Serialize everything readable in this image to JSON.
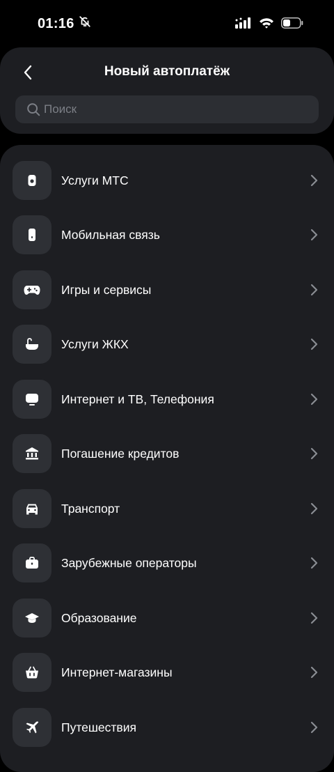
{
  "status_bar": {
    "time": "01:16",
    "icons": [
      "bell-slash-icon",
      "cellular-signal-icon",
      "wifi-icon",
      "battery-icon"
    ]
  },
  "header": {
    "title": "Новый автоплатёж",
    "back_icon": "chevron-left-icon"
  },
  "search": {
    "placeholder": "Поиск",
    "value": ""
  },
  "categories": [
    {
      "label": "Услуги МТС",
      "icon": "mts-icon"
    },
    {
      "label": "Мобильная связь",
      "icon": "phone-icon"
    },
    {
      "label": "Игры и сервисы",
      "icon": "gamepad-icon"
    },
    {
      "label": "Услуги ЖКХ",
      "icon": "bathtub-icon"
    },
    {
      "label": "Интернет и ТВ, Телефония",
      "icon": "tv-icon"
    },
    {
      "label": "Погашение кредитов",
      "icon": "bank-icon"
    },
    {
      "label": "Транспорт",
      "icon": "car-icon"
    },
    {
      "label": "Зарубежные операторы",
      "icon": "briefcase-icon"
    },
    {
      "label": "Образование",
      "icon": "graduation-cap-icon"
    },
    {
      "label": "Интернет-магазины",
      "icon": "shopping-basket-icon"
    },
    {
      "label": "Путешествия",
      "icon": "airplane-icon"
    }
  ],
  "colors": {
    "background": "#000000",
    "card": "#1d1e22",
    "icon_tile": "#2e3035",
    "search_field": "#2c2e33",
    "chevron": "#8a8d93"
  }
}
